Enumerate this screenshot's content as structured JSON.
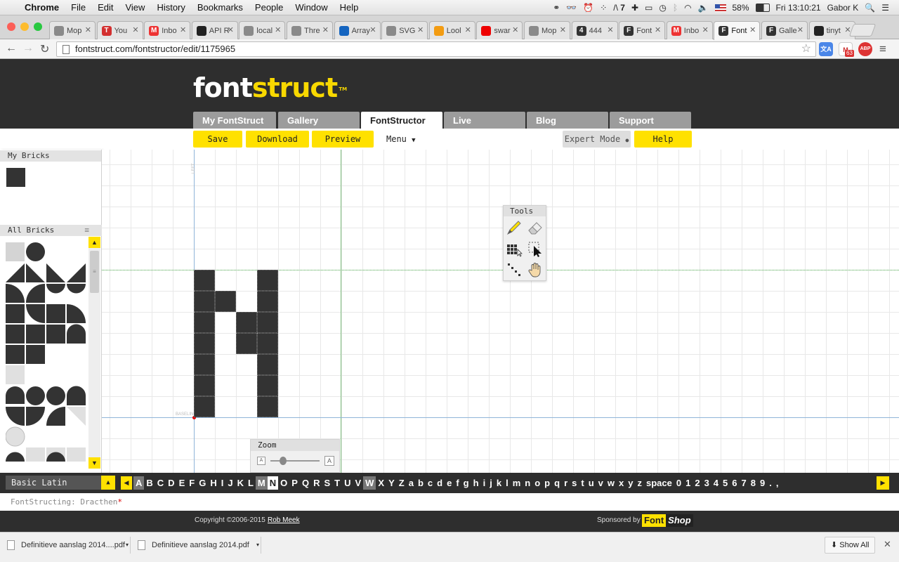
{
  "mac_menu": {
    "app": "Chrome",
    "items": [
      "File",
      "Edit",
      "View",
      "History",
      "Bookmarks",
      "People",
      "Window",
      "Help"
    ],
    "battery": "58%",
    "clock": "Fri 13:10:21",
    "user": "Gabor K",
    "notification_count": "7"
  },
  "tabs": [
    {
      "label": "Mop",
      "favicon": "doc-icon",
      "color": "#8a8a8a"
    },
    {
      "label": "You",
      "favicon": "T",
      "color": "#d32f2f"
    },
    {
      "label": "Inbo",
      "favicon": "M",
      "color": "#e33"
    },
    {
      "label": "API R",
      "favicon": "github-icon",
      "color": "#222"
    },
    {
      "label": "local",
      "favicon": "doc-icon",
      "color": "#8a8a8a"
    },
    {
      "label": "Thre",
      "favicon": "doc-icon",
      "color": "#8a8a8a"
    },
    {
      "label": "Array",
      "favicon": "mdn-icon",
      "color": "#1565c0"
    },
    {
      "label": "SVG",
      "favicon": "doc-icon",
      "color": "#8a8a8a"
    },
    {
      "label": "Lool",
      "favicon": "sun-icon",
      "color": "#f39c12"
    },
    {
      "label": "swar",
      "favicon": "youtube-icon",
      "color": "#e00"
    },
    {
      "label": "Mop",
      "favicon": "doc-icon",
      "color": "#8a8a8a"
    },
    {
      "label": "444",
      "favicon": "4",
      "color": "#333"
    },
    {
      "label": "Font",
      "favicon": "F",
      "color": "#333"
    },
    {
      "label": "Inbo",
      "favicon": "M",
      "color": "#e33"
    },
    {
      "label": "Font",
      "favicon": "F",
      "color": "#333",
      "active": true
    },
    {
      "label": "Galle",
      "favicon": "F",
      "color": "#333"
    },
    {
      "label": "tinyt",
      "favicon": "github-icon",
      "color": "#222"
    }
  ],
  "address": {
    "url": "fontstruct.com/fontstructor/edit/1175965",
    "badge": "63"
  },
  "site": {
    "logo_part1": "font",
    "logo_part2": "struct",
    "logo_tm": "TM",
    "nav": [
      "My FontStruct",
      "Gallery",
      "FontStructor",
      "Live",
      "Blog",
      "Support"
    ],
    "active_nav": "FontStructor"
  },
  "toolbar": {
    "save": "Save",
    "download": "Download",
    "preview": "Preview",
    "menu": "Menu",
    "expert": "Expert Mode",
    "help": "Help"
  },
  "sidebar": {
    "my_bricks": "My Bricks",
    "all_bricks": "All Bricks"
  },
  "canvas": {
    "left_label": "LEFT",
    "baseline_label": "BASELINE"
  },
  "glyph_cells": [
    [
      0,
      0
    ],
    [
      3,
      0
    ],
    [
      0,
      1
    ],
    [
      1,
      1
    ],
    [
      3,
      1
    ],
    [
      0,
      2
    ],
    [
      2,
      2
    ],
    [
      3,
      2
    ],
    [
      0,
      3
    ],
    [
      2,
      3
    ],
    [
      3,
      3
    ],
    [
      0,
      4
    ],
    [
      3,
      4
    ],
    [
      0,
      5
    ],
    [
      3,
      5
    ],
    [
      0,
      6
    ],
    [
      3,
      6
    ]
  ],
  "tools": {
    "title": "Tools",
    "items": [
      "pencil-icon",
      "eraser-icon",
      "grid-select-icon",
      "select-arrow-icon",
      "line-icon",
      "hand-icon"
    ]
  },
  "zoom": {
    "title": "Zoom",
    "level": 0.25
  },
  "charbar": {
    "subset": "Basic Latin",
    "chars": [
      "A",
      "B",
      "C",
      "D",
      "E",
      "F",
      "G",
      "H",
      "I",
      "J",
      "K",
      "L",
      "M",
      "N",
      "O",
      "P",
      "Q",
      "R",
      "S",
      "T",
      "U",
      "V",
      "W",
      "X",
      "Y",
      "Z",
      "a",
      "b",
      "c",
      "d",
      "e",
      "f",
      "g",
      "h",
      "i",
      "j",
      "k",
      "l",
      "m",
      "n",
      "o",
      "p",
      "q",
      "r",
      "s",
      "t",
      "u",
      "v",
      "w",
      "x",
      "y",
      "z",
      "space",
      "0",
      "1",
      "2",
      "3",
      "4",
      "5",
      "6",
      "7",
      "8",
      "9",
      ".",
      ","
    ],
    "done": [
      "A",
      "M",
      "W"
    ],
    "current": "N"
  },
  "status": {
    "prefix": "FontStructing: Dracthen",
    "modified": "*"
  },
  "footer": {
    "copyright": "Copyright ©2006-2015",
    "author": "Rob Meek",
    "sponsor": "Sponsored by",
    "sponsor_name1": "Font",
    "sponsor_name2": "Shop"
  },
  "downloads": {
    "items": [
      "Definitieve aanslag 2014....pdf",
      "Definitieve aanslag 2014.pdf"
    ],
    "show_all": "Show All"
  }
}
